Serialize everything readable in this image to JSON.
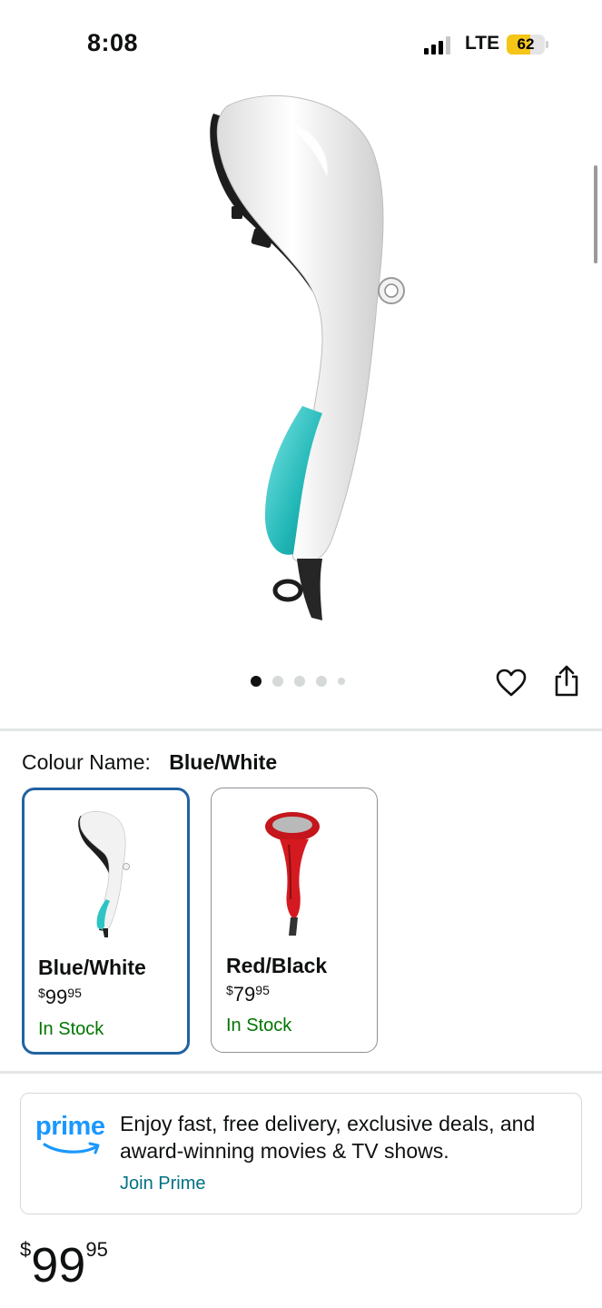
{
  "status_bar": {
    "time": "8:08",
    "network": "LTE",
    "battery": "62",
    "battery_level": 0.62
  },
  "carousel": {
    "total_images": 5,
    "active_index": 0
  },
  "icons": {
    "wishlist": "heart-icon",
    "share": "share-icon",
    "signal": "signal-bars-icon"
  },
  "colour": {
    "label": "Colour Name:",
    "selected": "Blue/White"
  },
  "variants": [
    {
      "name": "Blue/White",
      "price_symbol": "$",
      "price_whole": "99",
      "price_fraction": "95",
      "stock": "In Stock",
      "selected": true
    },
    {
      "name": "Red/Black",
      "price_symbol": "$",
      "price_whole": "79",
      "price_fraction": "95",
      "stock": "In Stock",
      "selected": false
    }
  ],
  "prime": {
    "logo_text": "prime",
    "message": "Enjoy fast, free delivery, exclusive deals, and award-winning movies & TV shows.",
    "link": "Join Prime"
  },
  "price": {
    "symbol": "$",
    "whole": "99",
    "fraction": "95"
  },
  "colors": {
    "selected_border": "#2162a1",
    "in_stock": "#007600",
    "link": "#007185",
    "prime_blue": "#1a98ff",
    "battery": "#f5c518"
  }
}
